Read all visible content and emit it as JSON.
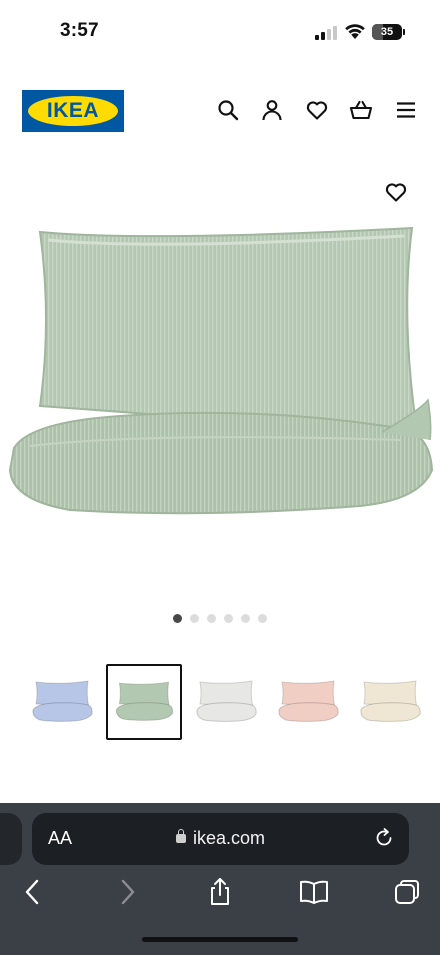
{
  "status_bar": {
    "time": "3:57",
    "battery": "35",
    "battery_level": 0.35
  },
  "header": {
    "logo_text": "IKEA",
    "icons": [
      "search-icon",
      "account-icon",
      "heart-icon",
      "basket-icon",
      "menu-icon"
    ]
  },
  "product": {
    "image": "green-pillow-duvet",
    "favorite_icon": "heart-icon",
    "image_count": 6,
    "active_image": 1
  },
  "thumbnails": [
    {
      "color": "#b7c6e6"
    },
    {
      "color": "#b3c8b0",
      "selected": true
    },
    {
      "color": "#e7e8e6"
    },
    {
      "color": "#f1cec4"
    },
    {
      "color": "#efe7d3"
    }
  ],
  "browser": {
    "aa_label": "AA",
    "url": "ikea.com",
    "toolbar_icons": [
      "back-icon",
      "forward-icon",
      "share-icon",
      "bookmarks-icon",
      "tabs-icon"
    ]
  },
  "colors": {
    "ikea_blue": "#0058a3",
    "ikea_yellow": "#ffdb00",
    "fabric_green": "#b3c8b0"
  }
}
